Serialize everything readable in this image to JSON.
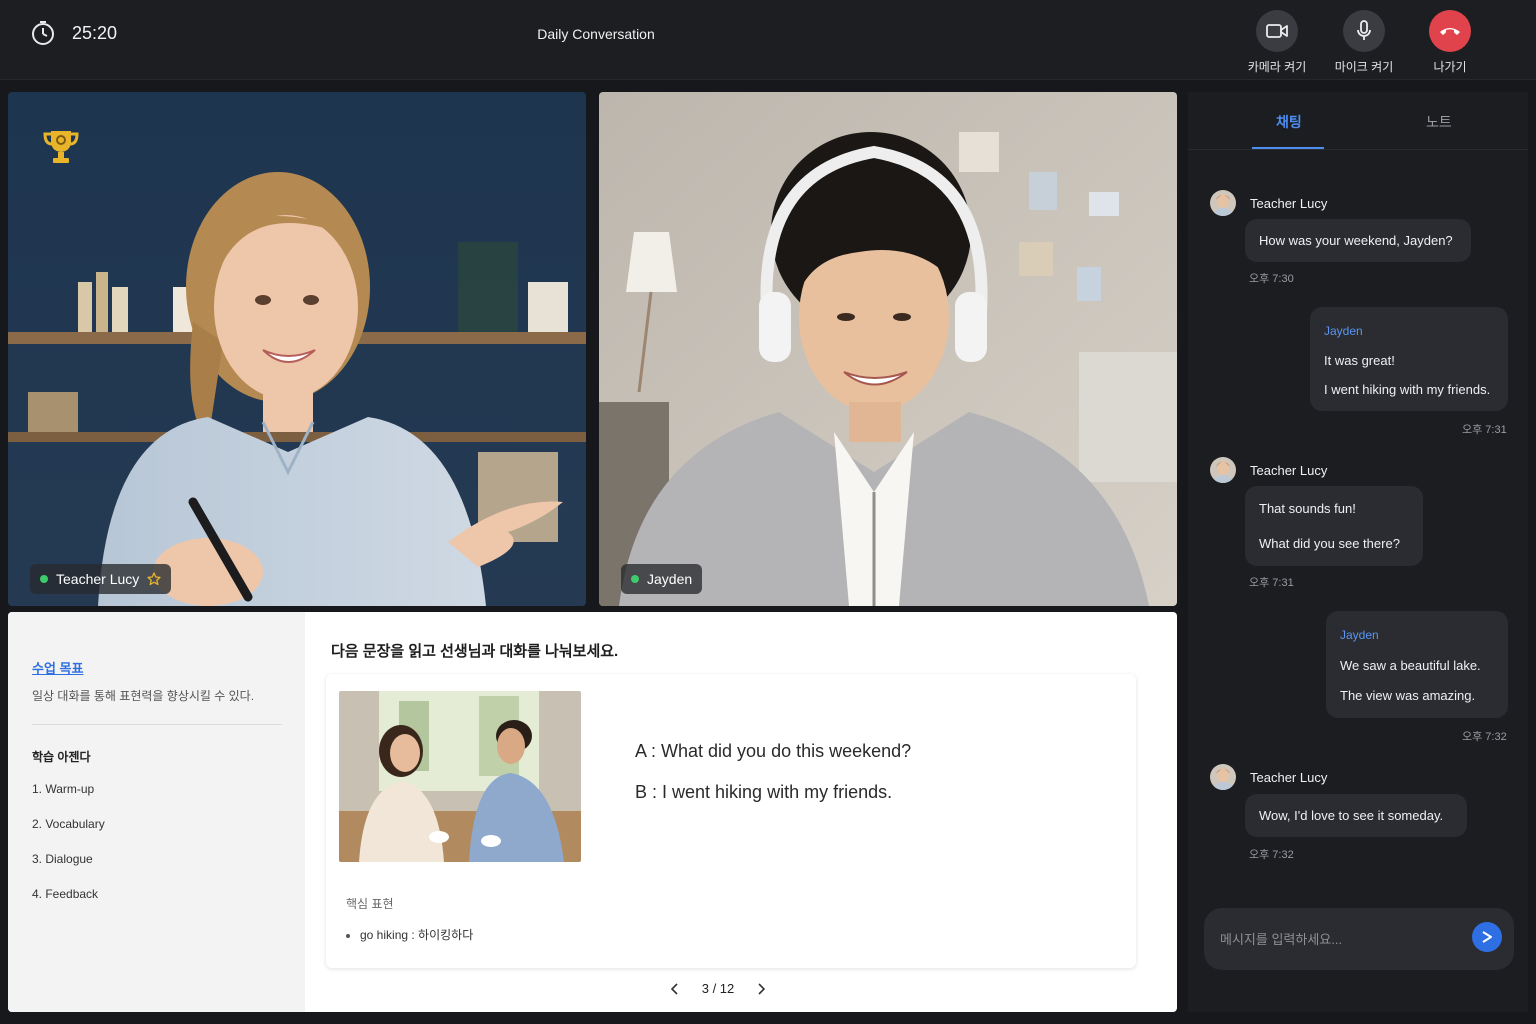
{
  "topbar": {
    "timer": "25:20",
    "title": "Daily Conversation",
    "camera_label": "카메라 켜기",
    "mic_label": "마이크 켜기",
    "leave_label": "나가기"
  },
  "videos": {
    "teacher_name": "Teacher Lucy",
    "student_name": "Jayden"
  },
  "lesson": {
    "goal_title": "수업 목표",
    "goal_text": "일상 대화를 통해 표현력을 향상시킬 수 있다.",
    "agenda_title": "학습 아젠다",
    "agenda": [
      "1.  Warm-up",
      "2.  Vocabulary",
      "3.  Dialogue",
      "4.  Feedback"
    ],
    "instruction": "다음 문장을 읽고 선생님과 대화를 나눠보세요.",
    "dialog_a": "A : What did you do this weekend?",
    "dialog_b": "B : I went hiking with my friends.",
    "key_title": "핵심 표현",
    "key_item": "go hiking : 하이킹하다",
    "page": "3 / 12"
  },
  "chat": {
    "tab_chat": "채팅",
    "tab_note": "노트",
    "messages": [
      {
        "sender": "Teacher Lucy",
        "lines": [
          "How was your weekend, Jayden?"
        ],
        "time": "오후 7:30"
      },
      {
        "sender": "Jayden",
        "lines": [
          "It was great!",
          "I went hiking with my friends."
        ],
        "time": "오후 7:31"
      },
      {
        "sender": "Teacher Lucy",
        "lines": [
          "That sounds fun!",
          "What did you see there?"
        ],
        "time": "오후 7:31"
      },
      {
        "sender": "Jayden",
        "lines": [
          "We saw a beautiful lake.",
          "The view was amazing."
        ],
        "time": "오후 7:32"
      },
      {
        "sender": "Teacher Lucy",
        "lines": [
          "Wow, I'd love to see it someday."
        ],
        "time": "오후 7:32"
      }
    ],
    "input_placeholder": "메시지를 입력하세요..."
  },
  "colors": {
    "accent": "#4e8df0",
    "leave": "#e0434b",
    "online": "#3fca6c",
    "trophy": "#e8b42a"
  }
}
